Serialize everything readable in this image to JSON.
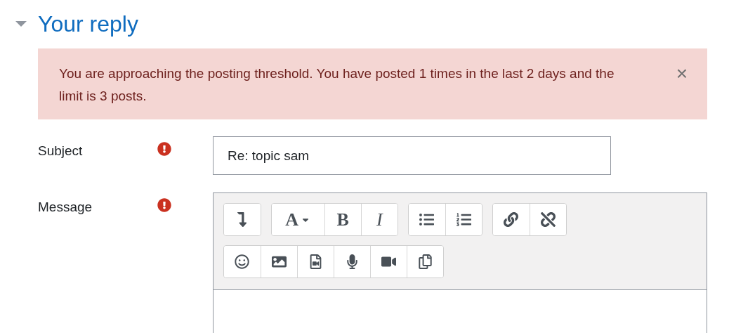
{
  "section": {
    "title": "Your reply",
    "expanded": true
  },
  "alert": {
    "text": "You are approaching the posting threshold. You have posted 1 times in the last 2 days and the limit is 3 posts.",
    "dismiss": "×"
  },
  "subject": {
    "label": "Subject",
    "required": true,
    "value": "Re: topic sam"
  },
  "message": {
    "label": "Message",
    "required": true,
    "toolbar": [
      [
        [
          {
            "kind": "indent"
          }
        ],
        [
          {
            "kind": "font",
            "label": "A"
          },
          {
            "kind": "bold",
            "label": "B"
          },
          {
            "kind": "italic",
            "label": "I"
          }
        ],
        [
          {
            "kind": "bullets"
          },
          {
            "kind": "numbers"
          }
        ],
        [
          {
            "kind": "link"
          },
          {
            "kind": "unlink"
          }
        ]
      ],
      [
        [
          {
            "kind": "emoji"
          },
          {
            "kind": "image"
          },
          {
            "kind": "media"
          },
          {
            "kind": "audio"
          },
          {
            "kind": "video"
          },
          {
            "kind": "copy"
          }
        ]
      ]
    ]
  }
}
